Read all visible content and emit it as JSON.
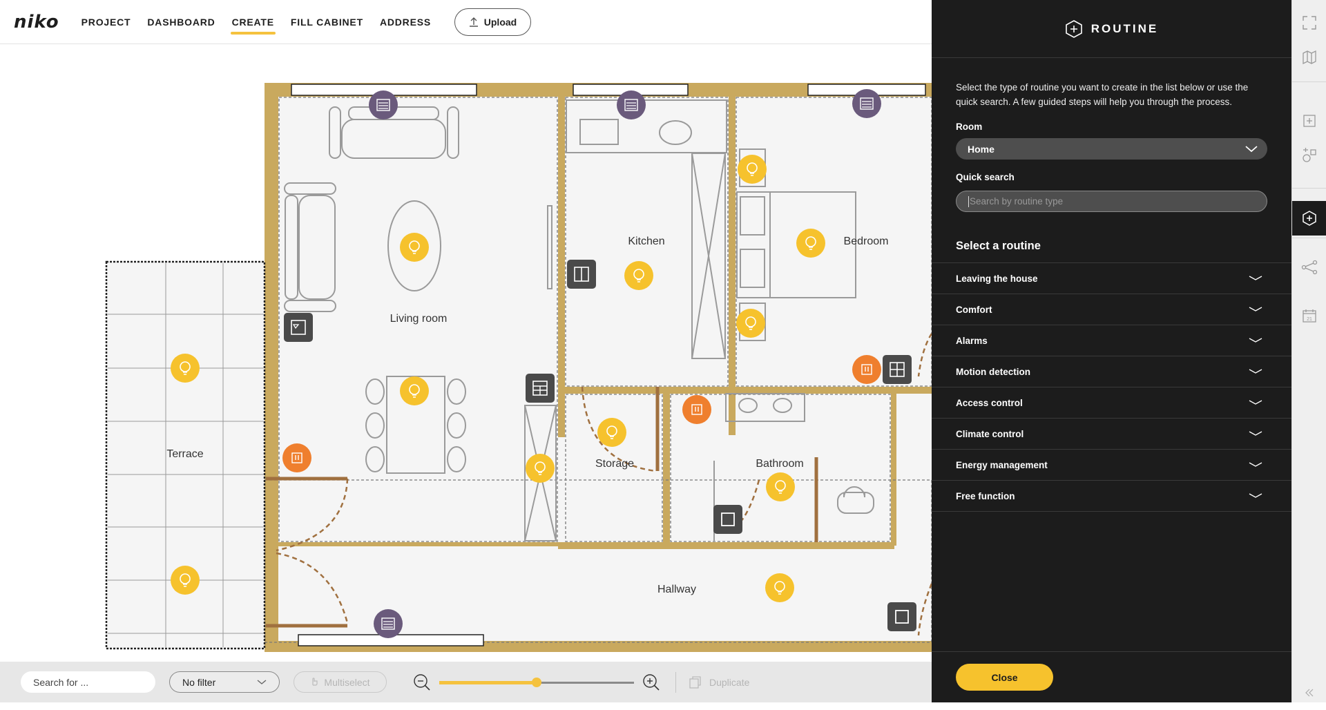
{
  "app": {
    "logo": "niko"
  },
  "nav": {
    "items": [
      {
        "label": "PROJECT",
        "active": false
      },
      {
        "label": "DASHBOARD",
        "active": false
      },
      {
        "label": "CREATE",
        "active": true
      },
      {
        "label": "FILL CABINET",
        "active": false
      },
      {
        "label": "ADDRESS",
        "active": false
      }
    ],
    "upload_label": "Upload"
  },
  "floorplan": {
    "rooms": {
      "living_room": "Living room",
      "kitchen": "Kitchen",
      "bedroom": "Bedroom",
      "terrace": "Terrace",
      "storage": "Storage",
      "bathroom": "Bathroom",
      "hallway": "Hallway"
    }
  },
  "bottombar": {
    "search_placeholder": "Search for ...",
    "filter_label": "No filter",
    "multiselect_label": "Multiselect",
    "zoom_level": 0.5,
    "duplicate_label": "Duplicate"
  },
  "panel": {
    "title": "ROUTINE",
    "intro": "Select the type of routine you want to create in the list below or use the quick search. A few guided steps will help you through the process.",
    "room_label": "Room",
    "room_value": "Home",
    "quick_search_label": "Quick search",
    "quick_search_placeholder": "Search by routine type",
    "select_title": "Select a routine",
    "routines": [
      "Leaving the house",
      "Comfort",
      "Alarms",
      "Motion detection",
      "Access control",
      "Climate control",
      "Energy management",
      "Free function"
    ],
    "close_label": "Close"
  },
  "colors": {
    "accent": "#f6c22d",
    "panel_bg": "#1c1c1c",
    "wall": "#c9a95e",
    "device_purple": "#6a5a7c",
    "device_orange": "#ef7f2e",
    "device_dark": "#4a4a4a"
  }
}
